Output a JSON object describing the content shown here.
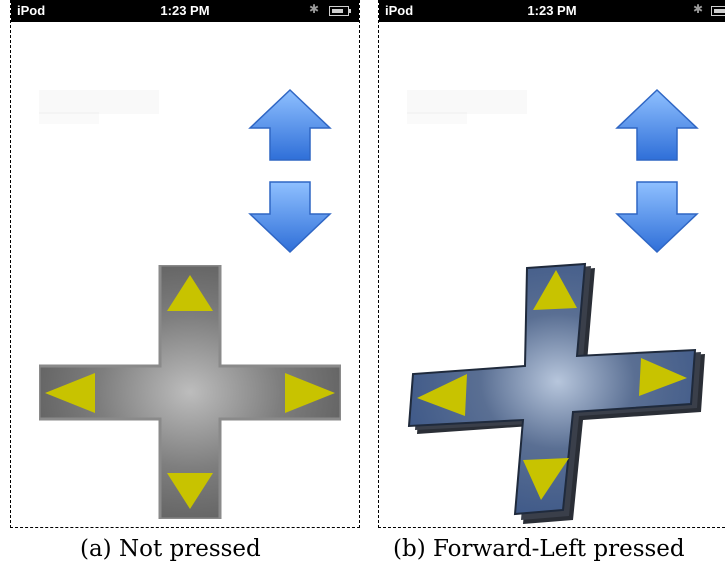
{
  "status_bar": {
    "carrier": "iPod",
    "time": "1:23 PM"
  },
  "colors": {
    "arrow_blue": "#4a8ff0",
    "dpad_gray": "#6b6b6b",
    "dpad_blue": "#3e5a8c",
    "triangle_yellow": "#c8c300"
  },
  "icons": [
    "up-arrow-icon",
    "down-arrow-icon",
    "dpad-icon",
    "triangle-icon",
    "bluetooth-icon",
    "battery-icon"
  ],
  "panels": [
    {
      "caption": "(a) Not pressed",
      "dpad_state": "not pressed"
    },
    {
      "caption": "(b) Forward-Left pressed",
      "dpad_state": "forward-left pressed"
    }
  ]
}
